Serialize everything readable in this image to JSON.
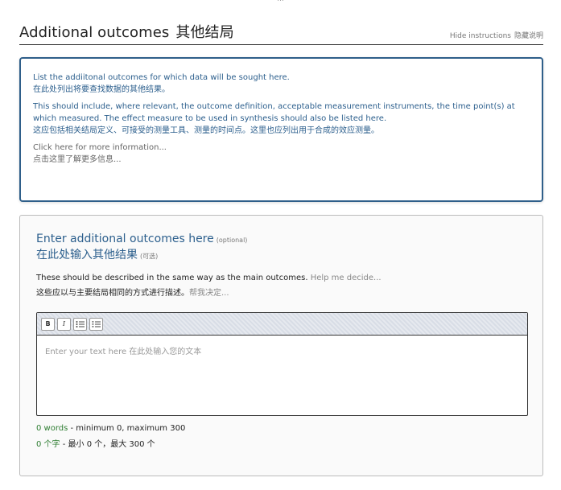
{
  "breadcrumb": "...",
  "header": {
    "title_en": "Additional outcomes",
    "title_zh": "其他结局",
    "hide_en": "Hide instructions",
    "hide_zh": "隐藏说明"
  },
  "instructions": {
    "line1_en": "List the addiitonal outcomes for which data will be sought here.",
    "line1_zh": "在此处列出将要查找数据的其他结果。",
    "line2_en": "This should include, where relevant, the outcome definition, acceptable measurement instruments, the time point(s) at which measured. The effect measure to be used in synthesis should also be listed here.",
    "line2_zh": "这应包括相关结局定义、可接受的测量工具、测量的时间点。这里也应列出用于合成的效应测量。",
    "more_en": "Click here for more information...",
    "more_zh": "点击这里了解更多信息..."
  },
  "field": {
    "label_en": "Enter additional outcomes here",
    "optional_en": "(optional)",
    "label_zh": "在此处输入其他结果",
    "optional_zh": "(可选)",
    "desc_en": "These should be described in the same way as the main outcomes.",
    "help_en": "Help me decide...",
    "desc_zh": "这些应以与主要结局相同的方式进行描述。",
    "help_zh": "帮我决定..."
  },
  "editor": {
    "bold_label": "B",
    "italic_label": "I",
    "bullet_icon": "bulleted-list-icon",
    "numbered_icon": "numbered-list-icon",
    "placeholder": "Enter your text here  在此处输入您的文本",
    "value": ""
  },
  "counter": {
    "words_en": "0 words",
    "limits_en": " - minimum 0, maximum 300",
    "words_zh": "0 个字",
    "limits_zh": " - 最小 0 个，最大 300 个"
  },
  "colors": {
    "accent": "#2c5f8d",
    "border_accent": "#2f5f8a",
    "ok": "#2e7d32"
  }
}
